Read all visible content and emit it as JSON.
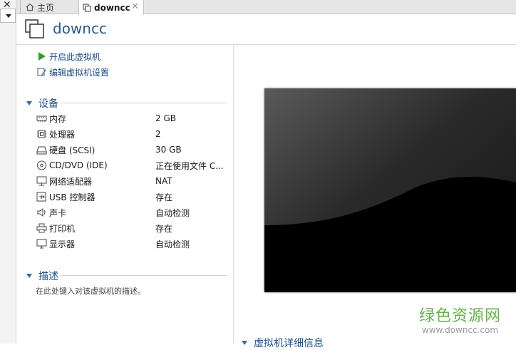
{
  "tabs": [
    {
      "label": "主页",
      "icon": "home-icon"
    },
    {
      "label": "downcc",
      "icon": "vm-tab-icon"
    }
  ],
  "vm": {
    "title": "downcc"
  },
  "actions": [
    {
      "label": "开启此虚拟机",
      "icon": "play-icon"
    },
    {
      "label": "编辑虚拟机设置",
      "icon": "edit-settings-icon"
    }
  ],
  "devices": {
    "heading": "设备",
    "items": [
      {
        "name": "内存",
        "value": "2 GB",
        "icon": "memory-icon"
      },
      {
        "name": "处理器",
        "value": "2",
        "icon": "cpu-icon"
      },
      {
        "name": "硬盘 (SCSI)",
        "value": "30 GB",
        "icon": "disk-icon"
      },
      {
        "name": "CD/DVD (IDE)",
        "value": "正在使用文件 C...",
        "icon": "cd-icon"
      },
      {
        "name": "网络适配器",
        "value": "NAT",
        "icon": "network-icon"
      },
      {
        "name": "USB 控制器",
        "value": "存在",
        "icon": "usb-icon"
      },
      {
        "name": "声卡",
        "value": "自动检测",
        "icon": "sound-icon"
      },
      {
        "name": "打印机",
        "value": "存在",
        "icon": "printer-icon"
      },
      {
        "name": "显示器",
        "value": "自动检测",
        "icon": "display-icon"
      }
    ]
  },
  "description": {
    "heading": "描述",
    "placeholder": "在此处键入对该虚拟机的描述。"
  },
  "details": {
    "heading": "虚拟机详细信息"
  },
  "watermark": {
    "main": "绿色资源网",
    "sub": "www.downcc.com"
  },
  "colors": {
    "accent": "#1a4f8a",
    "title": "#2a5b8f",
    "watermark": "#62b447"
  }
}
